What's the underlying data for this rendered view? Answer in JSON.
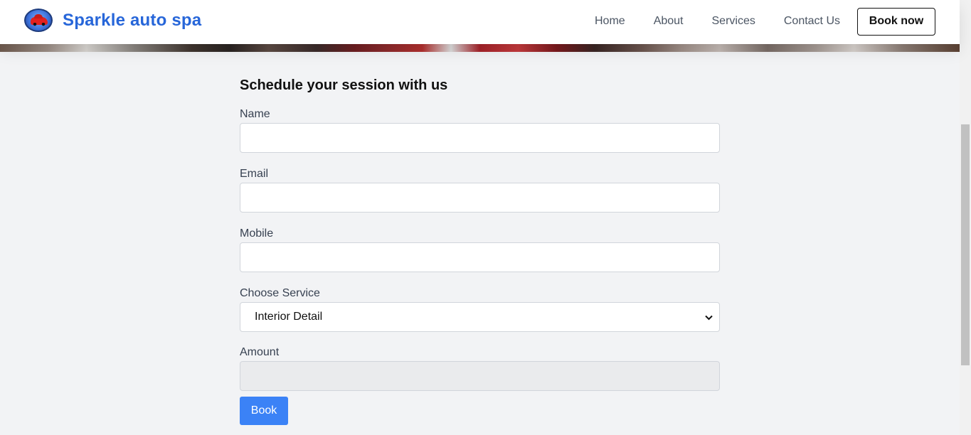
{
  "brand": {
    "name": "Sparkle auto spa",
    "logo_icon": "car-logo-icon"
  },
  "nav": {
    "links": [
      "Home",
      "About",
      "Services",
      "Contact Us"
    ],
    "cta": "Book now"
  },
  "form": {
    "title": "Schedule your session with us",
    "name_label": "Name",
    "name_value": "",
    "email_label": "Email",
    "email_value": "",
    "mobile_label": "Mobile",
    "mobile_value": "",
    "service_label": "Choose Service",
    "service_selected": "Interior Detail",
    "amount_label": "Amount",
    "amount_value": "",
    "submit_label": "Book"
  },
  "colors": {
    "brand": "#2766d9",
    "primary_button": "#3b82f6",
    "background": "#f2f3f5"
  }
}
